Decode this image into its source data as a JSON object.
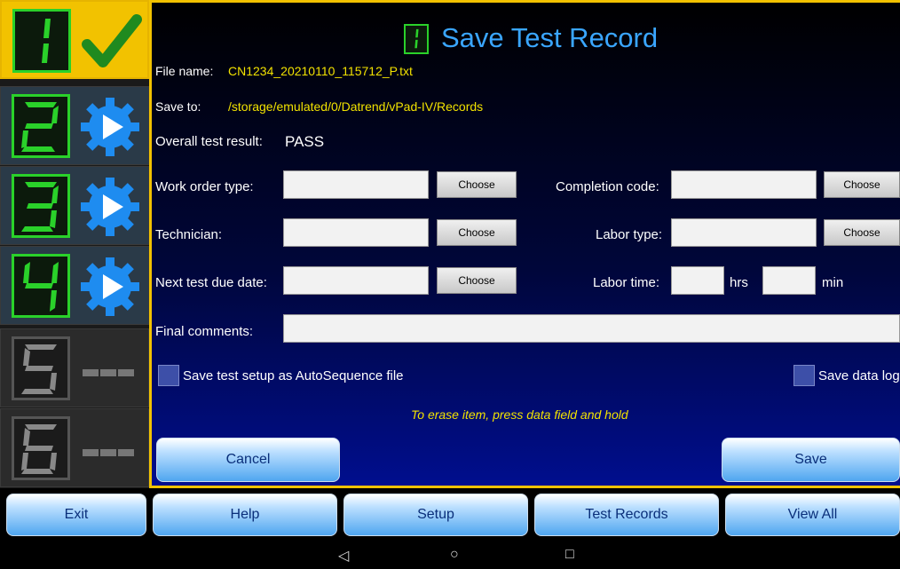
{
  "steps": [
    {
      "digit": "1",
      "status": "complete"
    },
    {
      "digit": "2",
      "status": "run"
    },
    {
      "digit": "3",
      "status": "run"
    },
    {
      "digit": "4",
      "status": "run"
    },
    {
      "digit": "5",
      "status": "empty"
    },
    {
      "digit": "6",
      "status": "empty"
    }
  ],
  "header": {
    "step_digit": "1",
    "title": "Save Test Record"
  },
  "file": {
    "label": "File name:",
    "value": "CN1234_20210110_115712_P.txt"
  },
  "save_to": {
    "label": "Save to:",
    "value": "/storage/emulated/0/Datrend/vPad-IV/Records"
  },
  "result": {
    "label": "Overall test result:",
    "value": "PASS"
  },
  "form": {
    "work_order_type": {
      "label": "Work order type:",
      "value": "",
      "button": "Choose"
    },
    "technician": {
      "label": "Technician:",
      "value": "",
      "button": "Choose"
    },
    "next_test_due": {
      "label": "Next test due date:",
      "value": "",
      "button": "Choose"
    },
    "completion_code": {
      "label": "Completion code:",
      "value": "",
      "button": "Choose"
    },
    "labor_type": {
      "label": "Labor type:",
      "value": "",
      "button": "Choose"
    },
    "labor_time": {
      "label": "Labor time:",
      "hrs_value": "",
      "hrs_unit": "hrs",
      "min_value": "",
      "min_unit": "min"
    },
    "final_comments": {
      "label": "Final comments:",
      "value": ""
    }
  },
  "options": {
    "save_autosequence": {
      "label": "Save test setup as AutoSequence file",
      "checked": false
    },
    "save_data_log": {
      "label": "Save data log",
      "checked": false
    }
  },
  "hint": "To erase item, press data field and hold",
  "actions": {
    "cancel": "Cancel",
    "save": "Save"
  },
  "nav": [
    "Exit",
    "Help",
    "Setup",
    "Test Records",
    "View All"
  ],
  "system_bar": {
    "back": "◁",
    "home": "○",
    "recents": "□"
  },
  "colors": {
    "accent_yellow": "#f2c200",
    "title_blue": "#3aa6ff",
    "digit_green": "#2ad12a",
    "value_yellow": "#f2e200"
  }
}
